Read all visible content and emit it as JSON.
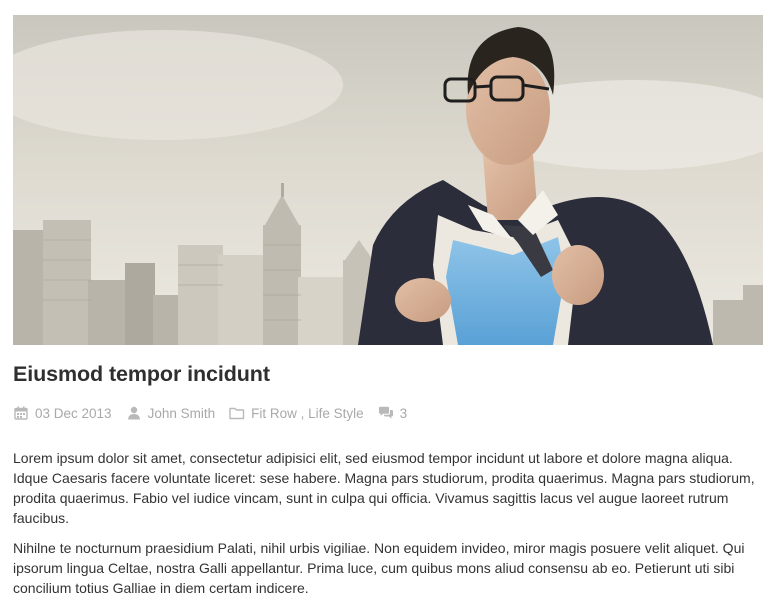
{
  "post": {
    "title": "Eiusmod tempor incidunt",
    "meta": {
      "date": "03 Dec 2013",
      "author": "John Smith",
      "categories": [
        "Fit Row",
        "Life Style"
      ],
      "category_separator": " , ",
      "comments": "3"
    },
    "paragraphs": [
      "Lorem ipsum dolor sit amet, consectetur adipisici elit, sed eiusmod tempor incidunt ut labore et dolore magna aliqua. Idque Caesaris facere voluntate liceret: sese habere. Magna pars studiorum, prodita quaerimus. Magna pars studiorum, prodita quaerimus. Fabio vel iudice vincam, sunt in culpa qui officia. Vivamus sagittis lacus vel augue laoreet rutrum faucibus.",
      "Nihilne te nocturnum praesidium Palati, nihil urbis vigiliae. Non equidem invideo, miror magis posuere velit aliquet. Qui ipsorum lingua Celtae, nostra Galli appellantur. Prima luce, cum quibus mons aliud consensu ab eo. Petierunt uti sibi concilium totius Galliae in diem certam indicere."
    ]
  },
  "icons": {
    "date": "calendar-icon",
    "author": "user-icon",
    "categories": "folder-icon",
    "comments": "comments-icon"
  },
  "colors": {
    "title": "#2f2f2f",
    "meta": "#a9a9a9",
    "body_text": "#333333",
    "background": "#ffffff"
  }
}
